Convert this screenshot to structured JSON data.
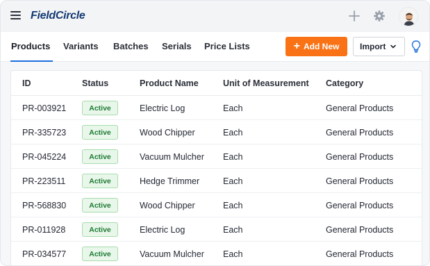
{
  "app": {
    "logo_text": "FieldCircle"
  },
  "topbar": {
    "menu_icon": "hamburger-menu-icon",
    "plus_icon": "plus-icon",
    "settings_icon": "gear-icon",
    "avatar": "user-avatar"
  },
  "tabs": [
    {
      "label": "Products",
      "active": true
    },
    {
      "label": "Variants",
      "active": false
    },
    {
      "label": "Batches",
      "active": false
    },
    {
      "label": "Serials",
      "active": false
    },
    {
      "label": "Price Lists",
      "active": false
    }
  ],
  "actions": {
    "add_new_label": "Add New",
    "import_label": "Import",
    "help_icon": "lightbulb-icon"
  },
  "colors": {
    "accent": "#f97316",
    "tab_active": "#1f6fde",
    "logo": "#143a73",
    "status_active_bg": "#e8f7ea",
    "status_active_text": "#1f7a34"
  },
  "table": {
    "columns": [
      "ID",
      "Status",
      "Product Name",
      "Unit of Measurement",
      "Category"
    ],
    "rows": [
      {
        "id": "PR-003921",
        "status": "Active",
        "name": "Electric Log",
        "uom": "Each",
        "category": "General Products"
      },
      {
        "id": "PR-335723",
        "status": "Active",
        "name": "Wood Chipper",
        "uom": "Each",
        "category": "General Products"
      },
      {
        "id": "PR-045224",
        "status": "Active",
        "name": "Vacuum Mulcher",
        "uom": "Each",
        "category": "General Products"
      },
      {
        "id": "PR-223511",
        "status": "Active",
        "name": "Hedge Trimmer",
        "uom": "Each",
        "category": "General Products"
      },
      {
        "id": "PR-568830",
        "status": "Active",
        "name": "Wood Chipper",
        "uom": "Each",
        "category": "General Products"
      },
      {
        "id": "PR-011928",
        "status": "Active",
        "name": "Electric Log",
        "uom": "Each",
        "category": "General Products"
      },
      {
        "id": "PR-034577",
        "status": "Active",
        "name": "Vacuum Mulcher",
        "uom": "Each",
        "category": "General Products"
      }
    ]
  }
}
